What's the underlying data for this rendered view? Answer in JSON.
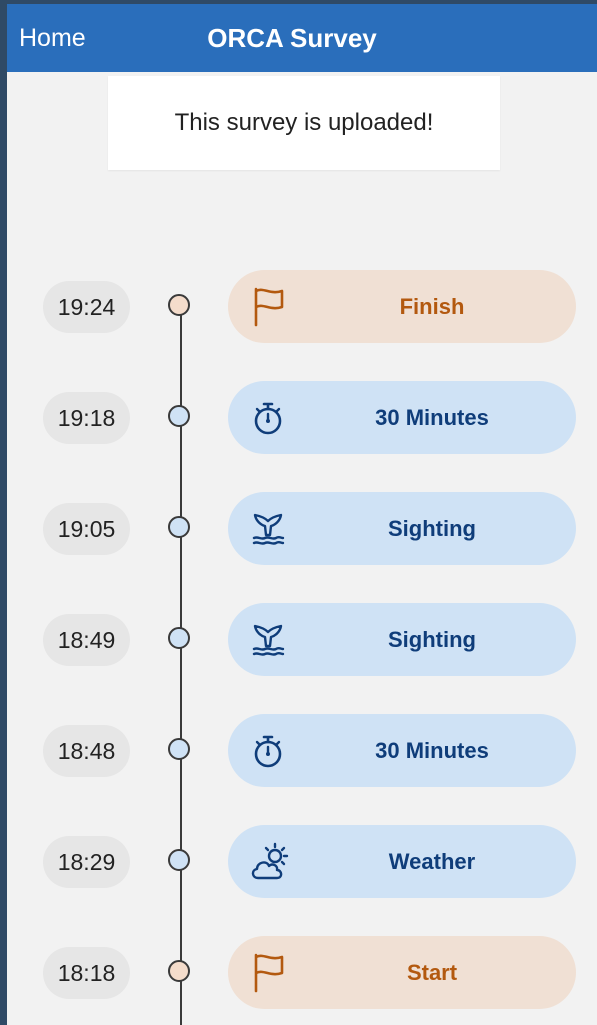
{
  "nav": {
    "home_label": "Home",
    "title": "ORCA Survey"
  },
  "banner": {
    "text": "This survey is uploaded!"
  },
  "colors": {
    "nav_bg": "#2a6ebb",
    "flag_bg": "#f0e0d4",
    "flag_fg": "#b3590f",
    "flag_dot": "#f4dccb",
    "event_bg": "#cfe2f5",
    "event_fg": "#0f3d7a",
    "event_dot": "#cfe2f5"
  },
  "events": [
    {
      "time": "19:24",
      "label": "Finish",
      "icon": "flag-icon",
      "kind": "flag"
    },
    {
      "time": "19:18",
      "label": "30 Minutes",
      "icon": "stopwatch-icon",
      "kind": "event"
    },
    {
      "time": "19:05",
      "label": "Sighting",
      "icon": "whale-tail-icon",
      "kind": "event"
    },
    {
      "time": "18:49",
      "label": "Sighting",
      "icon": "whale-tail-icon",
      "kind": "event"
    },
    {
      "time": "18:48",
      "label": "30 Minutes",
      "icon": "stopwatch-icon",
      "kind": "event"
    },
    {
      "time": "18:29",
      "label": "Weather",
      "icon": "weather-icon",
      "kind": "event"
    },
    {
      "time": "18:18",
      "label": "Start",
      "icon": "flag-icon",
      "kind": "flag"
    }
  ]
}
